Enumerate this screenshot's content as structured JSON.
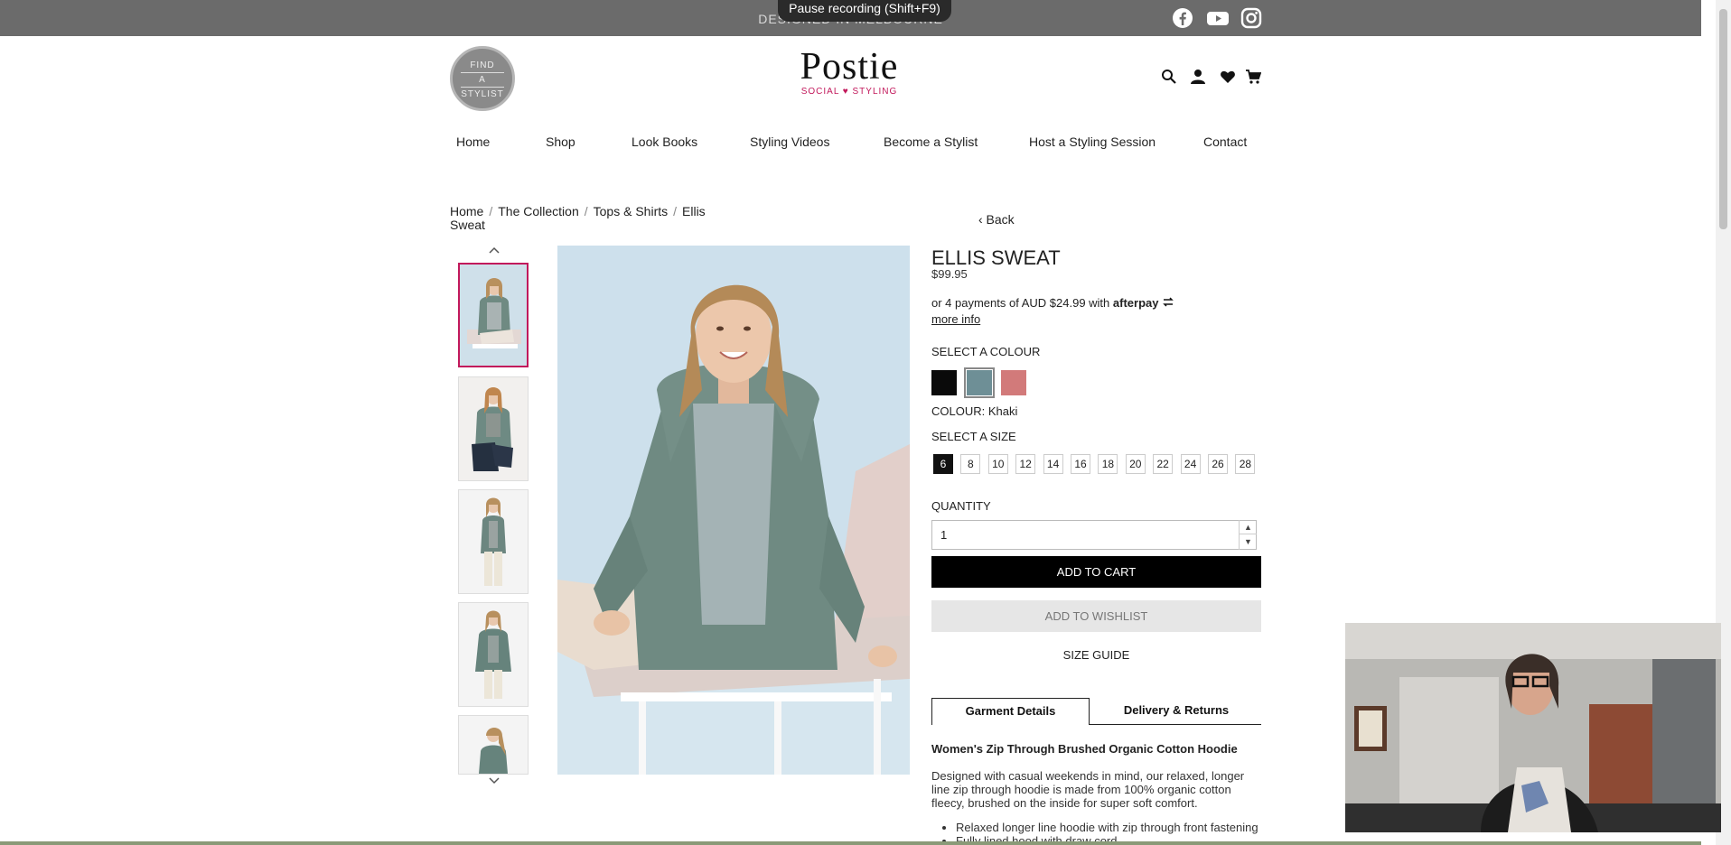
{
  "browser": {
    "recording_label": "Pause recording (Shift+F9)"
  },
  "topbar": {
    "tagline": "DESIGNED IN MELBOURNE",
    "social": [
      "facebook-icon",
      "youtube-icon",
      "instagram-icon"
    ]
  },
  "header": {
    "stylist_badge": [
      "FIND",
      "A",
      "STYLIST"
    ],
    "logo": "Postie",
    "logo_sub": "SOCIAL ♥ STYLING",
    "icons": [
      "search-icon",
      "account-icon",
      "heart-icon",
      "cart-icon"
    ]
  },
  "nav": {
    "items": [
      "Home",
      "Shop",
      "Look Books",
      "Styling Videos",
      "Become a Stylist",
      "Host a Styling Session",
      "Contact"
    ]
  },
  "breadcrumb": {
    "items": [
      "Home",
      "The Collection",
      "Tops & Shirts",
      "Ellis Sweat"
    ],
    "back": "‹ Back"
  },
  "product": {
    "name": "ELLIS SWEAT",
    "price": "$99.95",
    "afterpay_text": "or 4 payments of AUD $24.99 with",
    "afterpay_brand": "afterpay",
    "more_info": "more info",
    "select_colour_label": "SELECT A COLOUR",
    "colours": [
      {
        "name": "Black",
        "hex": "#0a0a0a"
      },
      {
        "name": "Khaki",
        "hex": "#6e8f96"
      },
      {
        "name": "Rose",
        "hex": "#d27a7a"
      }
    ],
    "selected_colour_index": 1,
    "colour_display": "COLOUR: Khaki",
    "select_size_label": "SELECT A SIZE",
    "sizes": [
      "6",
      "8",
      "10",
      "12",
      "14",
      "16",
      "18",
      "20",
      "22",
      "24",
      "26",
      "28"
    ],
    "selected_size": "6",
    "quantity_label": "QUANTITY",
    "quantity_value": "1",
    "add_to_cart": "ADD TO CART",
    "add_to_wishlist": "ADD TO WISHLIST",
    "size_guide": "SIZE GUIDE"
  },
  "tabs": [
    "Garment Details",
    "Delivery & Returns"
  ],
  "details": {
    "title": "Women's Zip Through Brushed Organic Cotton Hoodie",
    "body": "Designed with casual weekends in mind, our relaxed, longer line zip through hoodie is made from 100% organic cotton fleecy, brushed on the inside for super soft comfort.",
    "bullets": [
      "Relaxed longer line hoodie with zip through front fastening",
      "Fully lined hood with draw cord"
    ]
  },
  "colors": {
    "accent": "#c2185b",
    "topbar": "#6b6b6b"
  }
}
